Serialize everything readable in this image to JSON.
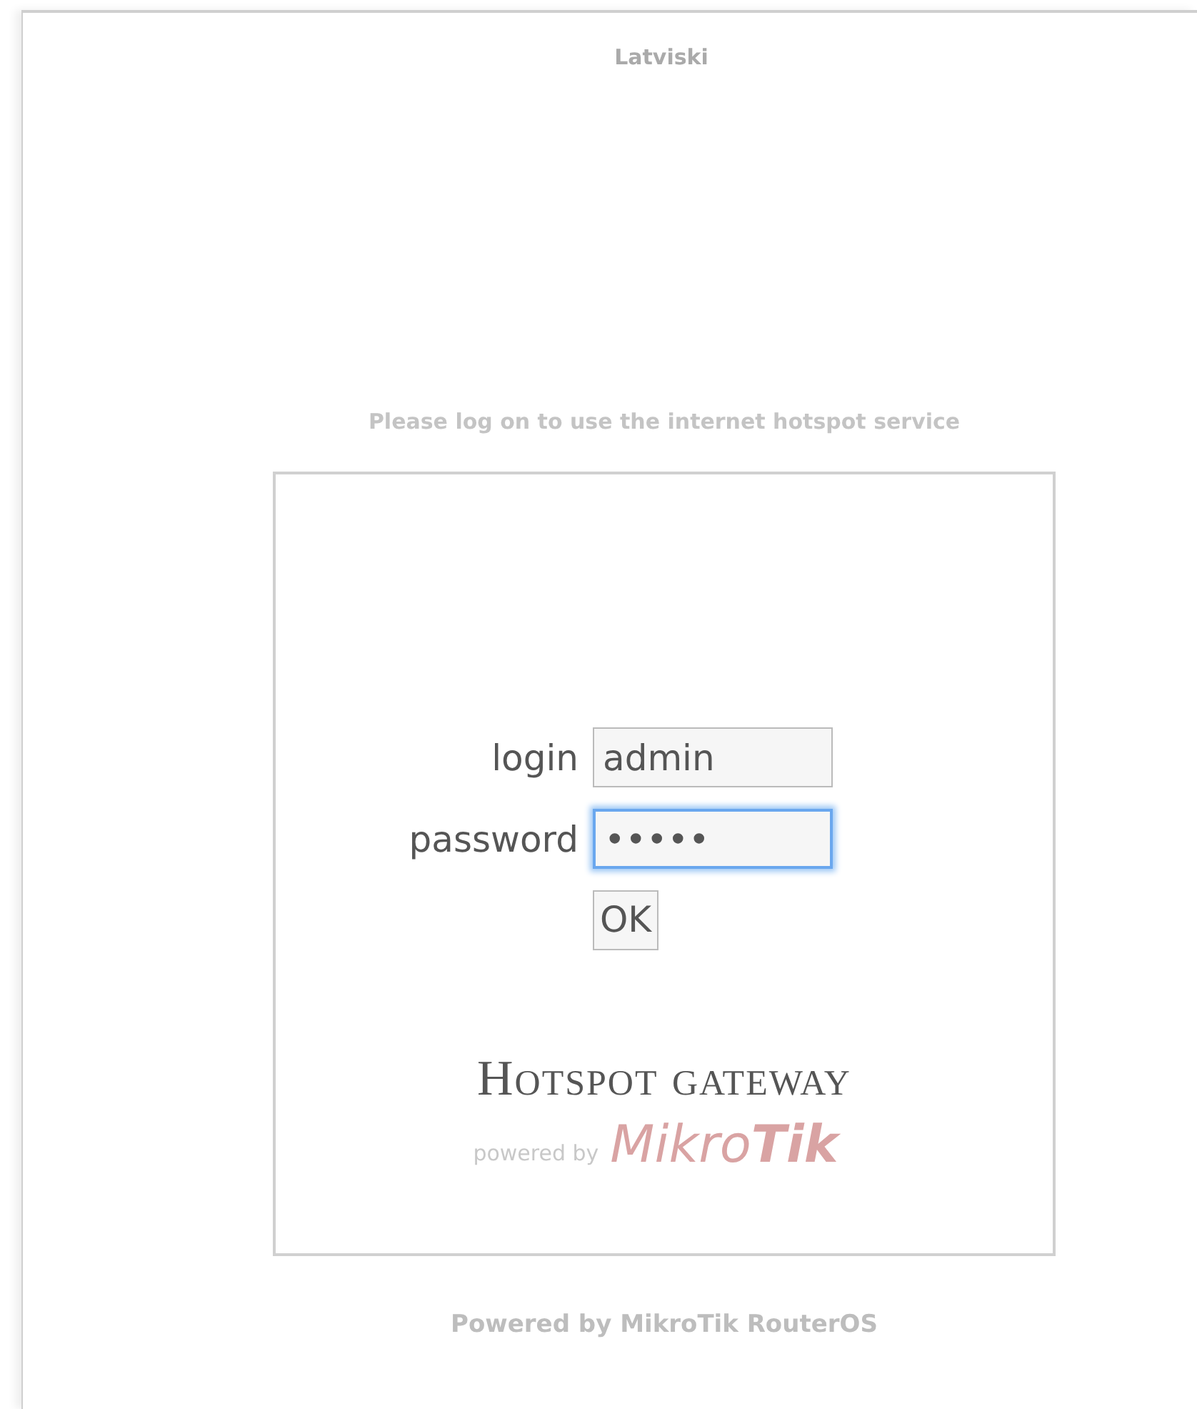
{
  "language_link": "Latviski",
  "message": "Please log on to use the internet hotspot service",
  "form": {
    "login": {
      "label": "login",
      "value": "admin",
      "focused": false
    },
    "password": {
      "label": "password",
      "value": "•••••",
      "focused": true
    },
    "submit": "OK"
  },
  "logo": {
    "title": "Hotspot gateway",
    "powered_by": "powered by",
    "brand_light": "Mikro",
    "brand_bold": "Tik"
  },
  "footer": "Powered by MikroTik RouterOS"
}
